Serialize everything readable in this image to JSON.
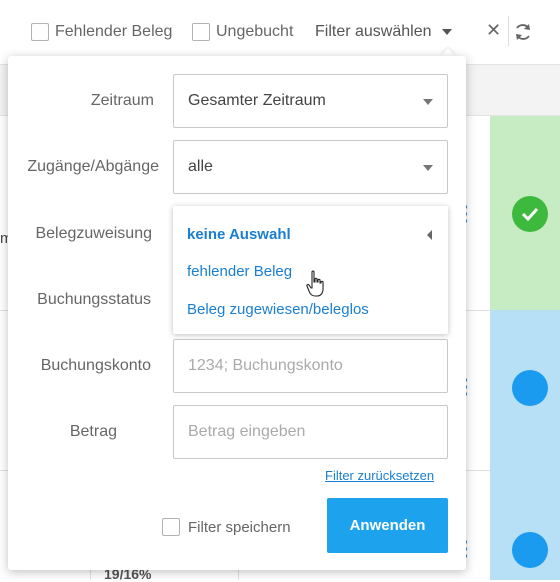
{
  "toolbar": {
    "missing_receipt_label": "Fehlender Beleg",
    "unbooked_label": "Ungebucht",
    "filter_select_label": "Filter auswählen",
    "close_glyph": "✕"
  },
  "background": {
    "row_cut_text": "m",
    "percent_text": "19/16%"
  },
  "filter_panel": {
    "period": {
      "label": "Zeitraum",
      "value": "Gesamter Zeitraum"
    },
    "inflow_outflow": {
      "label": "Zugänge/Abgänge",
      "value": "alle"
    },
    "receipt_assignment": {
      "label": "Belegzuweisung",
      "options": [
        "keine Auswahl",
        "fehlender Beleg",
        "Beleg zugewiesen/beleglos"
      ],
      "selected": "keine Auswahl",
      "hovered": "fehlender Beleg"
    },
    "booking_status": {
      "label": "Buchungsstatus"
    },
    "booking_account": {
      "label": "Buchungskonto",
      "placeholder": "1234; Buchungskonto"
    },
    "amount": {
      "label": "Betrag",
      "placeholder": "Betrag eingeben"
    },
    "reset_link": "Filter zurücksetzen",
    "save_filter_label": "Filter speichern",
    "apply_button": "Anwenden"
  },
  "colors": {
    "accent": "#1da3ee",
    "link": "#1a7fd1",
    "status_green": "#3dba3d",
    "row_green": "#c7ebc2",
    "row_blue": "#b7dff5"
  }
}
